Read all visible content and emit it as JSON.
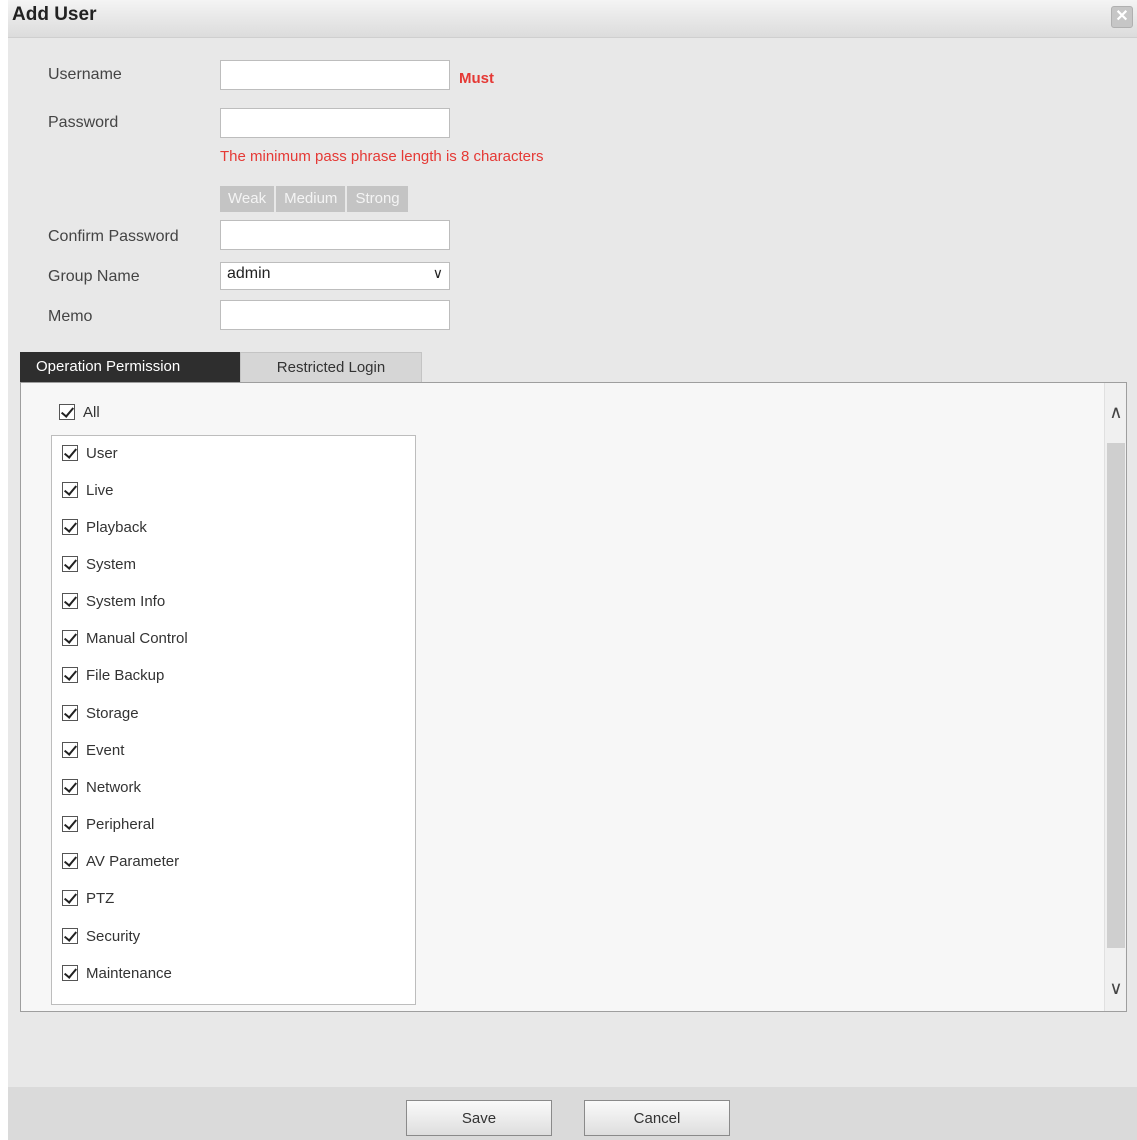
{
  "dialog": {
    "title": "Add User",
    "close_symbol": "✕"
  },
  "form": {
    "username_label": "Username",
    "username_value": "",
    "must_text": "Must",
    "password_label": "Password",
    "password_value": "",
    "password_hint": "The minimum pass phrase length is 8 characters",
    "strength": [
      "Weak",
      "Medium",
      "Strong"
    ],
    "confirm_label": "Confirm Password",
    "confirm_value": "",
    "group_label": "Group Name",
    "group_value": "admin",
    "memo_label": "Memo",
    "memo_value": ""
  },
  "tabs": [
    {
      "label": "Operation Permission",
      "active": true
    },
    {
      "label": "Restricted Login",
      "active": false
    }
  ],
  "permissions": {
    "all_label": "All",
    "all_checked": true,
    "items": [
      {
        "label": "User",
        "checked": true
      },
      {
        "label": "Live",
        "checked": true
      },
      {
        "label": "Playback",
        "checked": true
      },
      {
        "label": "System",
        "checked": true
      },
      {
        "label": "System Info",
        "checked": true
      },
      {
        "label": "Manual Control",
        "checked": true
      },
      {
        "label": "File Backup",
        "checked": true
      },
      {
        "label": "Storage",
        "checked": true
      },
      {
        "label": "Event",
        "checked": true
      },
      {
        "label": "Network",
        "checked": true
      },
      {
        "label": "Peripheral",
        "checked": true
      },
      {
        "label": "AV Parameter",
        "checked": true
      },
      {
        "label": "PTZ",
        "checked": true
      },
      {
        "label": "Security",
        "checked": true
      },
      {
        "label": "Maintenance",
        "checked": true
      }
    ]
  },
  "footer": {
    "save_label": "Save",
    "cancel_label": "Cancel"
  },
  "icons": {
    "scroll_up": "chevron-up-icon",
    "scroll_down": "chevron-down-icon",
    "select_arrow": "chevron-down-icon",
    "close": "close-icon"
  }
}
